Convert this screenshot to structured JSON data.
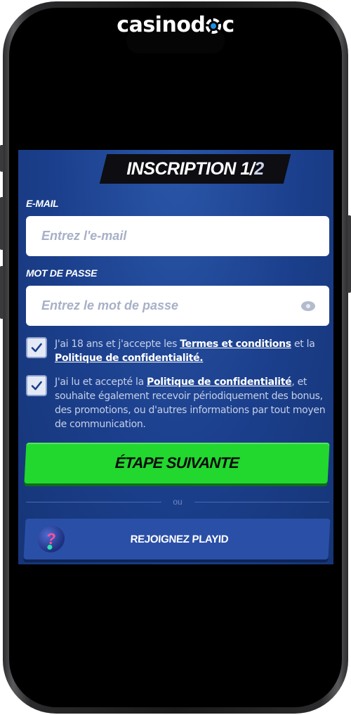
{
  "brand": {
    "logo_text_before": "casinod",
    "logo_text_after": "c"
  },
  "form": {
    "title_main": "INSCRIPTION 1/",
    "title_step_total": "2",
    "email_label": "E-MAIL",
    "email_placeholder": "Entrez l'e-mail",
    "email_value": "",
    "password_label": "MOT DE PASSE",
    "password_placeholder": "Entrez le mot de passe",
    "password_value": "",
    "consent1": {
      "checked": true,
      "text_before": "J'ai 18 ans et j'accepte les ",
      "link1": "Termes et conditions",
      "text_middle": " et la ",
      "link2": "Politique de confidentialité."
    },
    "consent2": {
      "checked": true,
      "text_before": "J'ai lu et accepté la ",
      "link": "Politique de confidentialité",
      "text_after": ", et souhaite également recevoir périodiquement des bonus, des promotions, ou d'autres informations par tout moyen de communication."
    },
    "next_button": "ÉTAPE SUIVANTE",
    "divider_text": "ou",
    "playid_button": "REJOIGNEZ PLAYID"
  },
  "colors": {
    "panel_background": "#1b3f8c",
    "primary_button": "#22d82f",
    "secondary_button": "#2a4fa6"
  },
  "icons": [
    "eye-icon",
    "checkmark-icon",
    "playid-icon",
    "poker-chip-icon"
  ]
}
